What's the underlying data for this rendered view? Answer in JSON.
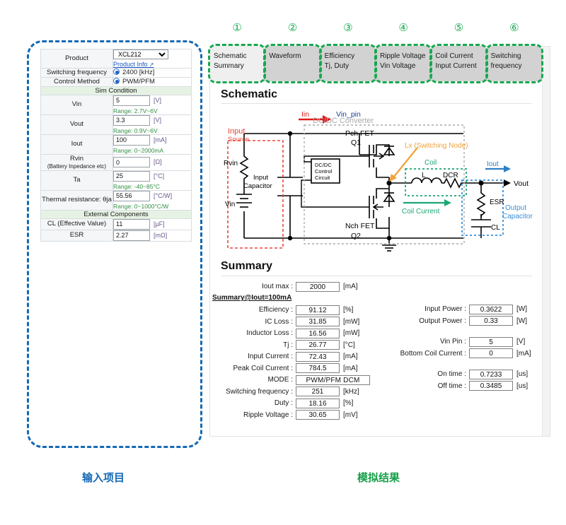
{
  "input_panel": {
    "rows": [
      {
        "label": "Product",
        "type": "select",
        "value": "XCL212",
        "link": "Product Info",
        "link_icon": "external-link-icon"
      },
      {
        "label": "Switching frequency",
        "type": "radio",
        "value": "2400 [kHz]"
      },
      {
        "label": "Control Method",
        "type": "radio",
        "value": "PWM/PFM"
      },
      {
        "label": "Sim Condition",
        "type": "section"
      },
      {
        "label": "Vin",
        "type": "text",
        "value": "5",
        "unit": "[V]",
        "range": "Range: 2.7V~6V"
      },
      {
        "label": "Vout",
        "type": "text",
        "value": "3.3",
        "unit": "[V]",
        "range": "Range: 0.9V~6V"
      },
      {
        "label": "Iout",
        "type": "text",
        "value": "100",
        "unit": "[mA]",
        "range": "Range: 0~2000mA"
      },
      {
        "label": "Rvin",
        "sub_label": "(Battery Inpedance etc)",
        "type": "text",
        "value": "0",
        "unit": "[Ω]",
        "range": ""
      },
      {
        "label": "Ta",
        "type": "text",
        "value": "25",
        "unit": "[°C]",
        "range": "Range: -40~85°C"
      },
      {
        "label": "Thermal resistance: θja",
        "type": "text",
        "value": "55.56",
        "unit": "[°C/W]",
        "range": "Range: 0~1000°C/W"
      },
      {
        "label": "External Components",
        "type": "section"
      },
      {
        "label": "CL (Effective Value)",
        "type": "text",
        "value": "11",
        "unit": "[μF]",
        "range": ""
      },
      {
        "label": "ESR",
        "type": "text",
        "value": "2.27",
        "unit": "[mΩ]",
        "range": ""
      }
    ]
  },
  "tabs": [
    {
      "number": "①",
      "line1": "Schematic",
      "line2": "Summary",
      "active": true
    },
    {
      "number": "②",
      "line1": "Waveform",
      "line2": "",
      "active": false
    },
    {
      "number": "③",
      "line1": "Efficiency",
      "line2": "Tj, Duty",
      "active": false
    },
    {
      "number": "④",
      "line1": "Ripple Voltage",
      "line2": "Vin Voltage",
      "active": false
    },
    {
      "number": "⑤",
      "line1": "Coil Current",
      "line2": "Input Current",
      "active": false
    },
    {
      "number": "⑥",
      "line1": "Switching",
      "line2": "frequency",
      "active": false
    }
  ],
  "schematic": {
    "heading": "Schematic",
    "labels": {
      "iin": "Iin",
      "vin_pin": "Vin_pin",
      "input_source": "Input",
      "input_source2": "Source",
      "rvin": "Rvin",
      "vin": "Vin",
      "input_capacitor1": "Input",
      "input_capacitor2": "Capacitor",
      "converter": "DC/DC Converter",
      "pch": "Pch FET",
      "q1": "Q1",
      "nch": "Nch FET",
      "q2": "Q2",
      "ctrl1": "DC/DC",
      "ctrl2": "Control",
      "ctrl3": "Circuit",
      "lx": "Lx (Switching Node)",
      "coil": "Coil",
      "l": "L",
      "dcr": "DCR",
      "coil_current": "Coil Current",
      "iout": "Iout",
      "vout": "Vout",
      "esr": "ESR",
      "cl": "CL",
      "output_cap1": "Output",
      "output_cap2": "Capacitor"
    },
    "colors": {
      "input_source": "#e8453c",
      "converter_box": "#aaaaaa",
      "lx": "#f0a13c",
      "coil": "#1aa873",
      "output_cap": "#3a8fd8",
      "iin_arrow": "#e01b1b"
    }
  },
  "summary": {
    "heading": "Summary",
    "subhead": "Summary@Iout=100mA",
    "iout_max": {
      "key": "Iout max :",
      "value": "2000",
      "unit": "[mA]"
    },
    "left_rows": [
      {
        "key": "Efficiency :",
        "value": "91.12",
        "unit": "[%]"
      },
      {
        "key": "IC Loss :",
        "value": "31.85",
        "unit": "[mW]"
      },
      {
        "key": "Inductor Loss :",
        "value": "16.56",
        "unit": "[mW]"
      },
      {
        "key": "Tj :",
        "value": "26.77",
        "unit": "[°C]"
      },
      {
        "key": "Input Current :",
        "value": "72.43",
        "unit": "[mA]"
      },
      {
        "key": "Peak Coil Current :",
        "value": "784.5",
        "unit": "[mA]"
      },
      {
        "key": "MODE :",
        "value": "PWM/PFM  DCM",
        "unit": ""
      },
      {
        "key": "Switching frequency :",
        "value": "251",
        "unit": "[kHz]"
      },
      {
        "key": "Duty :",
        "value": "18.16",
        "unit": "[%]"
      },
      {
        "key": "Ripple Voltage :",
        "value": "30.65",
        "unit": "[mV]"
      }
    ],
    "right_groups": [
      [
        {
          "key": "Input Power :",
          "value": "0.3622",
          "unit": "[W]"
        },
        {
          "key": "Output Power :",
          "value": "0.33",
          "unit": "[W]"
        }
      ],
      [
        {
          "key": "Vin Pin :",
          "value": "5",
          "unit": "[V]"
        },
        {
          "key": "Bottom Coil Current :",
          "value": "0",
          "unit": "[mA]"
        }
      ],
      [
        {
          "key": "On time :",
          "value": "0.7233",
          "unit": "[us]"
        },
        {
          "key": "Off time :",
          "value": "0.3485",
          "unit": "[us]"
        }
      ]
    ]
  },
  "captions": {
    "left": "输入项目",
    "right": "模拟结果"
  }
}
